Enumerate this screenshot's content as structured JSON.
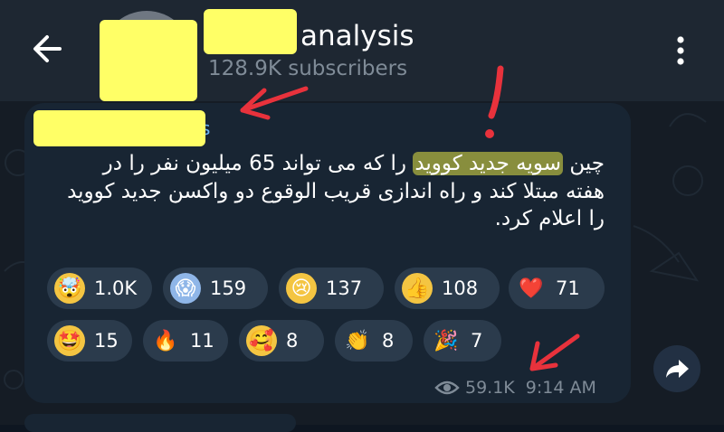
{
  "header": {
    "title": "analysis",
    "subscribers": "128.9K subscribers"
  },
  "message": {
    "text_before": "چین",
    "text_highlight": "سویه جدید کووید",
    "text_after": "را که می تواند 65 میلیون نفر را در هفته مبتلا کند و راه اندازی قریب الوقوع دو واکسن جدید کووید را اعلام کرد.",
    "views": "59.1K",
    "time": "9:14 AM"
  },
  "reactions": [
    {
      "emoji": "🤯",
      "count": "1.0K"
    },
    {
      "emoji": "😱",
      "count": "159"
    },
    {
      "emoji": "😢",
      "count": "137"
    },
    {
      "emoji": "👍",
      "count": "108"
    },
    {
      "emoji": "❤️",
      "count": "71"
    },
    {
      "emoji": "🤩",
      "count": "15"
    },
    {
      "emoji": "🔥",
      "count": "11"
    },
    {
      "emoji": "🥰",
      "count": "8"
    },
    {
      "emoji": "👏",
      "count": "8"
    },
    {
      "emoji": "🎉",
      "count": "7"
    }
  ],
  "colors": {
    "header_bg": "#1e2732",
    "bubble_bg": "#182533",
    "reaction_bg": "#2b3b4c",
    "redaction": "#ffff66",
    "annotation": "#e8323c"
  },
  "icons": {
    "back": "arrow-left-icon",
    "menu": "more-vertical-icon",
    "views": "eye-icon",
    "share": "share-arrow-icon"
  }
}
